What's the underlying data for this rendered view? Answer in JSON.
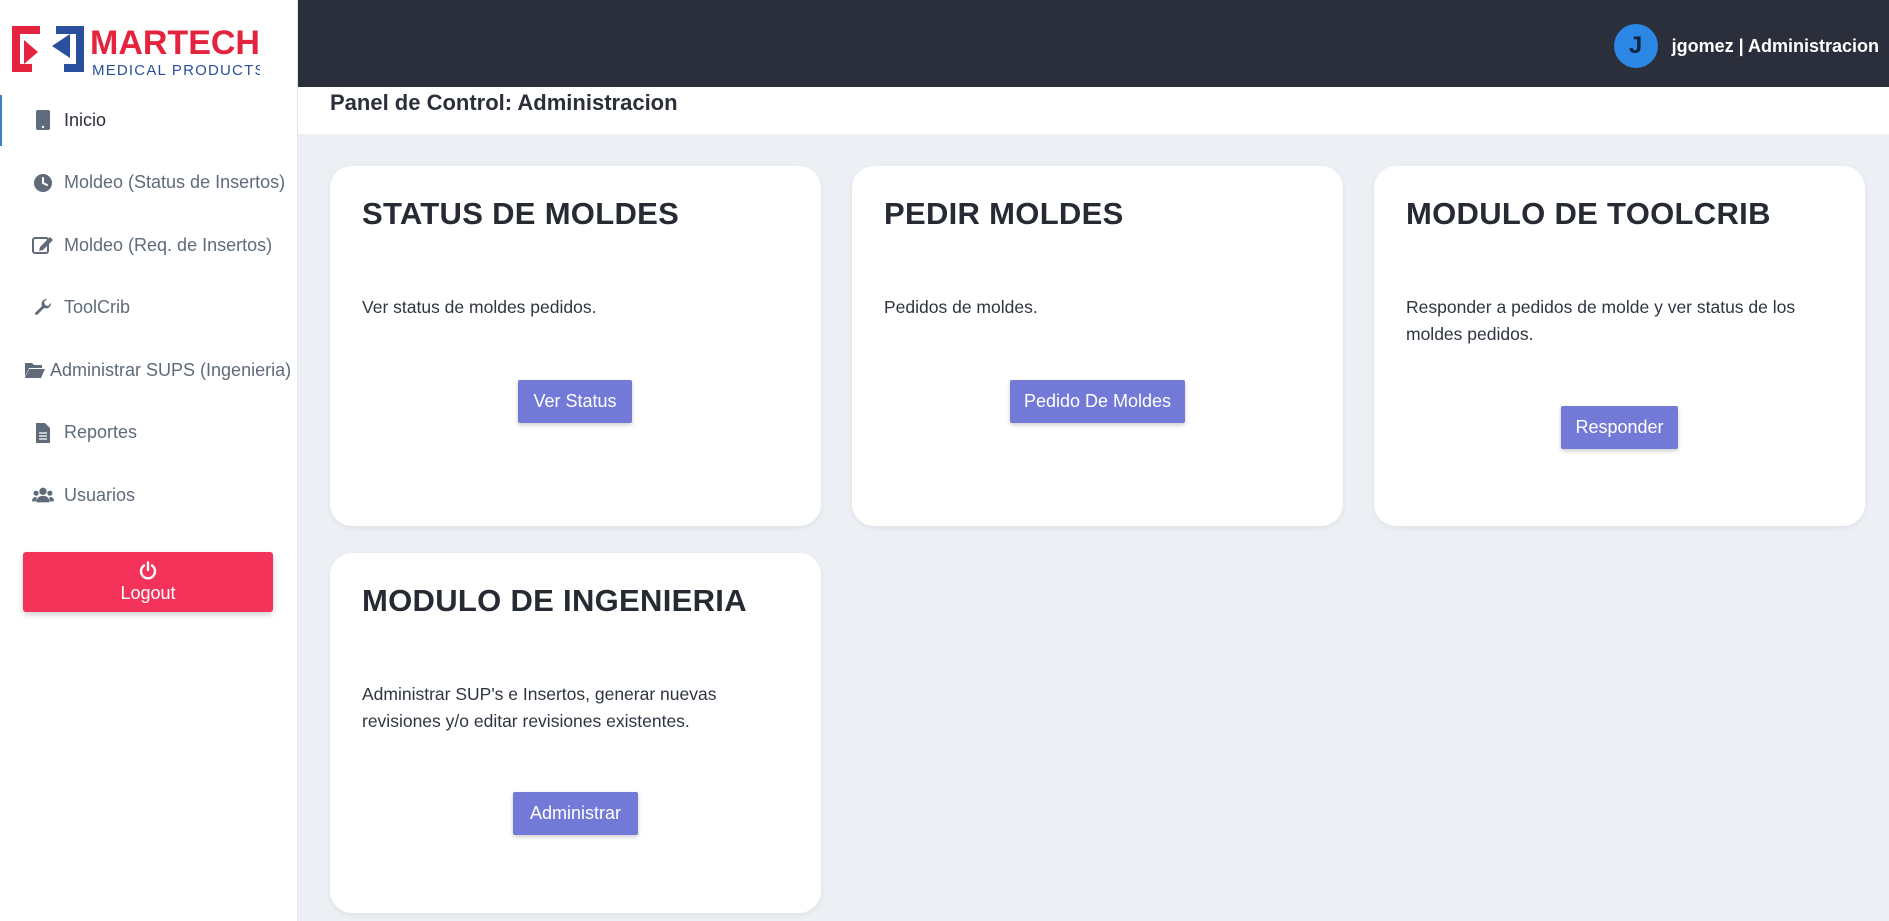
{
  "brand": {
    "name_top": "MARTECH",
    "name_bottom": "MEDICAL PRODUCTS",
    "colors": {
      "red": "#e4233f",
      "blue": "#2a4f9c"
    }
  },
  "sidebar": {
    "items": [
      {
        "label": "Inicio",
        "icon": "tablet-icon",
        "active": true
      },
      {
        "label": "Moldeo (Status de Insertos)",
        "icon": "clock-icon",
        "active": false
      },
      {
        "label": "Moldeo (Req. de Insertos)",
        "icon": "edit-icon",
        "active": false
      },
      {
        "label": "ToolCrib",
        "icon": "wrench-icon",
        "active": false
      },
      {
        "label": "Administrar SUPS (Ingenieria)",
        "icon": "folder-open-icon",
        "active": false
      },
      {
        "label": "Reportes",
        "icon": "file-icon",
        "active": false
      },
      {
        "label": "Usuarios",
        "icon": "users-icon",
        "active": false
      }
    ],
    "logout_label": "Logout"
  },
  "header": {
    "avatar_initial": "J",
    "user_label": "jgomez | Administracion"
  },
  "page": {
    "title": "Panel de Control: Administracion"
  },
  "cards": [
    {
      "title": "STATUS DE MOLDES",
      "description": "Ver status de moldes pedidos.",
      "button": "Ver Status"
    },
    {
      "title": "PEDIR MOLDES",
      "description": "Pedidos de moldes.",
      "button": "Pedido De Moldes"
    },
    {
      "title": "MODULO DE TOOLCRIB",
      "description": "Responder a pedidos de molde y ver status de los moldes pedidos.",
      "button": "Responder"
    },
    {
      "title": "MODULO DE INGENIERIA",
      "description": "Administrar SUP's e Insertos, generar nuevas revisiones y/o editar revisiones existentes.",
      "button": "Administrar"
    }
  ],
  "colors": {
    "topbar": "#2b2e3b",
    "button": "#7279d6",
    "logout": "#f4335a",
    "avatar": "#2b86e4"
  }
}
